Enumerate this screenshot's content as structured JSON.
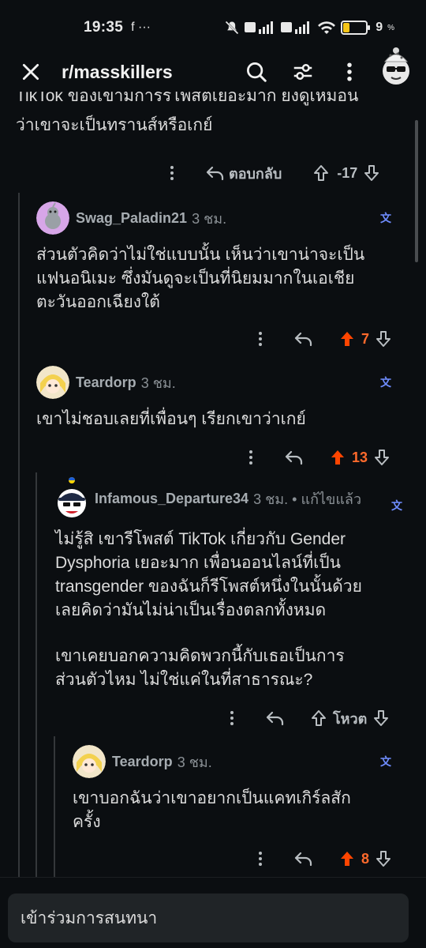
{
  "status_bar": {
    "time": "19:35",
    "icons": "f ···",
    "battery": "9",
    "battery_level": 0.09
  },
  "header": {
    "title": "r/masskillers"
  },
  "previous_comment": {
    "text_cut": "TikTok ของเขามีการรีโพสต์เยอะมาก ยังดูเหมือน",
    "text_last": "ว่าเขาจะเป็นทรานส์หรือเกย์",
    "reply_label": "ตอบกลับ",
    "score": "-17"
  },
  "comments": [
    {
      "username": "Swag_Paladin21",
      "time": "3 ชม.",
      "lines": [
        "ส่วนตัวคิดว่าไม่ใช่แบบนั้น เห็นว่าเขาน่าจะเป็น",
        "แฟนอนิเมะ ซึ่งมันดูจะเป็นที่นิยมมากในเอเชีย",
        "ตะวันออกเฉียงใต้"
      ],
      "score": "7"
    },
    {
      "username": "Teardorp",
      "time": "3 ชม.",
      "lines": [
        "เขาไม่ชอบเลยที่เพื่อนๆ เรียกเขาว่าเกย์"
      ],
      "score": "13"
    },
    {
      "username": "Infamous_Departure34",
      "time": "3 ชม. • แก้ไขแล้ว",
      "lines": [
        "ไม่รู้สิ เขารีโพสต์ TikTok เกี่ยวกับ Gender",
        "Dysphoria เยอะมาก เพื่อนออนไลน์ที่เป็น",
        "transgender ของฉันก็รีโพสต์หนึ่งในนั้นด้วย",
        "เลยคิดว่ามันไม่น่าเป็นเรื่องตลกทั้งหมด"
      ],
      "lines2": [
        "เขาเคยบอกความคิดพวกนี้กับเธอเป็นการ",
        "ส่วนตัวไหม ไม่ใช่แค่ในที่สาธารณะ?"
      ],
      "score": "โหวต"
    },
    {
      "username": "Teardorp",
      "time": "3 ชม.",
      "lines": [
        "เขาบอกฉันว่าเขาอยากเป็นแคทเกิร์ลสัก",
        "ครั้ง"
      ],
      "score": "8"
    }
  ],
  "translate_icon": "文",
  "join": {
    "placeholder": "เข้าร่วมการสนทนา"
  },
  "colors": {
    "upvote": "#ff4500",
    "score_orange": "#ff6a2c",
    "translate": "#6f8dff"
  }
}
